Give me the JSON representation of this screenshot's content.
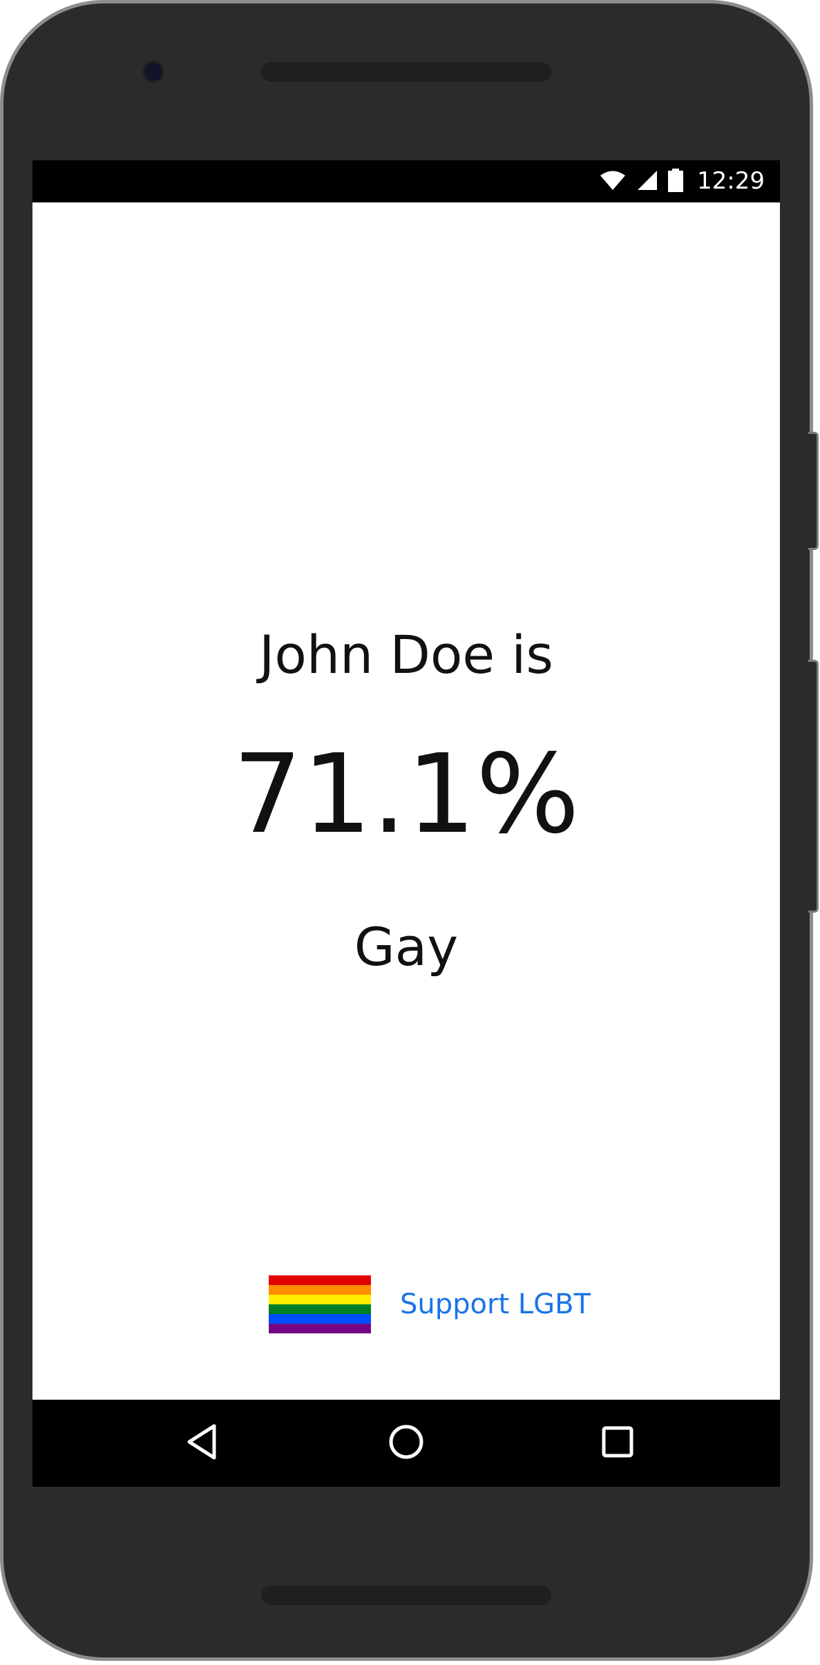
{
  "status_bar": {
    "time": "12:29",
    "icons": [
      "wifi-icon",
      "signal-icon",
      "battery-icon"
    ]
  },
  "result": {
    "intro": "John Doe is",
    "percent": "71.1%",
    "label": "Gay"
  },
  "support": {
    "flag_icon": "rainbow-flag-icon",
    "flag_colors": [
      "#e40303",
      "#ff8c00",
      "#ffed00",
      "#008026",
      "#004dff",
      "#750787"
    ],
    "link_label": "Support LGBT",
    "link_color": "#1a73e8"
  },
  "nav_bar": {
    "buttons": [
      "back-icon",
      "home-icon",
      "recents-icon"
    ]
  }
}
